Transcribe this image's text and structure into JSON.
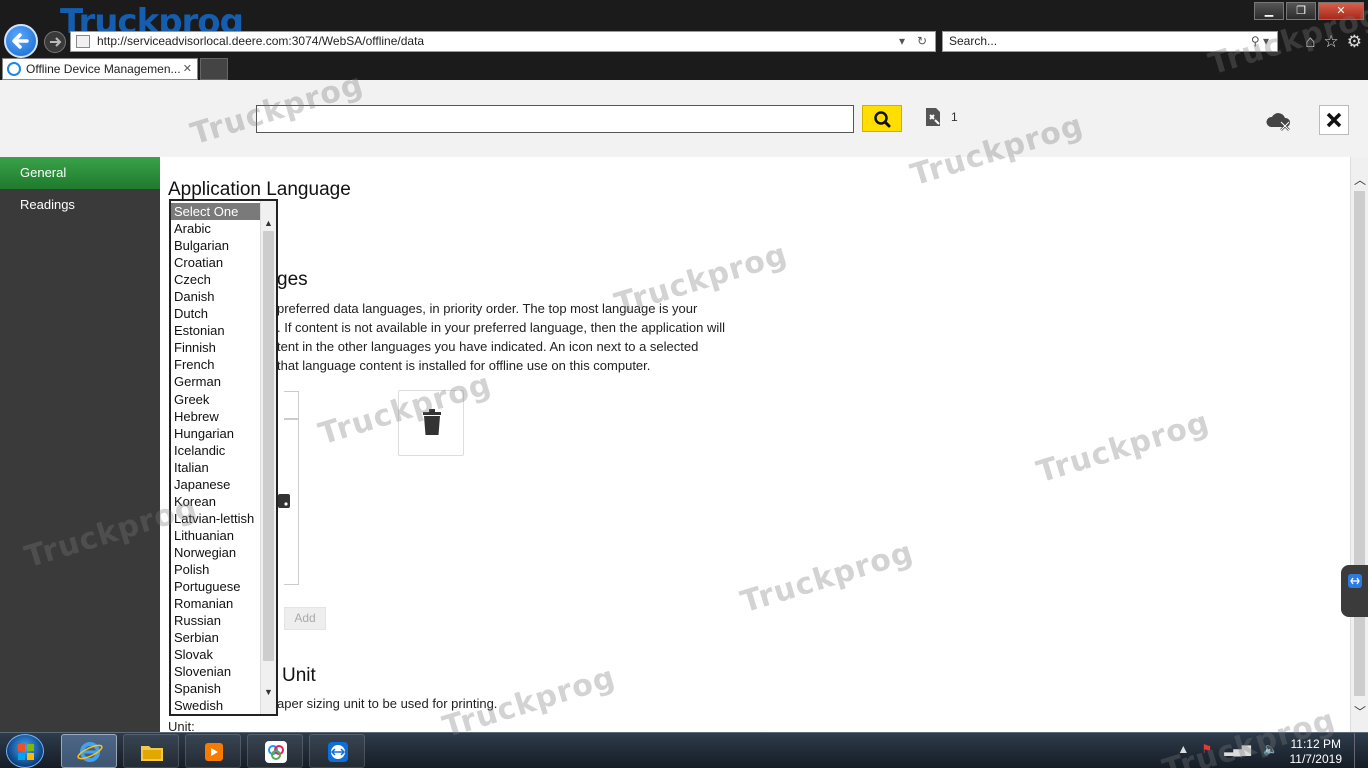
{
  "browser": {
    "brand_overlay": "Truckprog",
    "address": "http://serviceadvisorlocal.deere.com:3074/WebSA/offline/data",
    "search_placeholder": "Search...",
    "tab_title": "Offline Device Managemen...",
    "tab_close": "✕"
  },
  "header": {
    "search_value": "",
    "cart_count": "1"
  },
  "sidebar": {
    "items": [
      {
        "label": "General",
        "active": true
      },
      {
        "label": "Readings",
        "active": false
      }
    ]
  },
  "main": {
    "app_language_title": "Application Language",
    "data_languages_title_visible": "ges",
    "data_languages_desc_lines": [
      "preferred data languages, in priority order. The top most language is your",
      ". If content is not available in your preferred language, then the application will",
      "tent in the other languages you have indicated. An icon next to a selected",
      "that language content is installed for offline use on this computer."
    ],
    "add_label": "Add",
    "unit_title_visible": "Unit",
    "unit_desc_visible": "aper sizing unit to be used for printing.",
    "unit_label": "Unit:"
  },
  "language_dropdown": {
    "selected": "Select One",
    "options": [
      "Select One",
      "Arabic",
      "Bulgarian",
      "Croatian",
      "Czech",
      "Danish",
      "Dutch",
      "Estonian",
      "Finnish",
      "French",
      "German",
      "Greek",
      "Hebrew",
      "Hungarian",
      "Icelandic",
      "Italian",
      "Japanese",
      "Korean",
      "Latvian-lettish",
      "Lithuanian",
      "Norwegian",
      "Polish",
      "Portuguese",
      "Romanian",
      "Russian",
      "Serbian",
      "Slovak",
      "Slovenian",
      "Spanish",
      "Swedish"
    ]
  },
  "taskbar": {
    "time": "11:12 PM",
    "date": "11/7/2019"
  },
  "watermark": "Truckprog",
  "colors": {
    "accent_green": "#2e8b3d",
    "search_button_yellow": "#ffde00",
    "sidebar_bg": "#3a3a3a"
  }
}
